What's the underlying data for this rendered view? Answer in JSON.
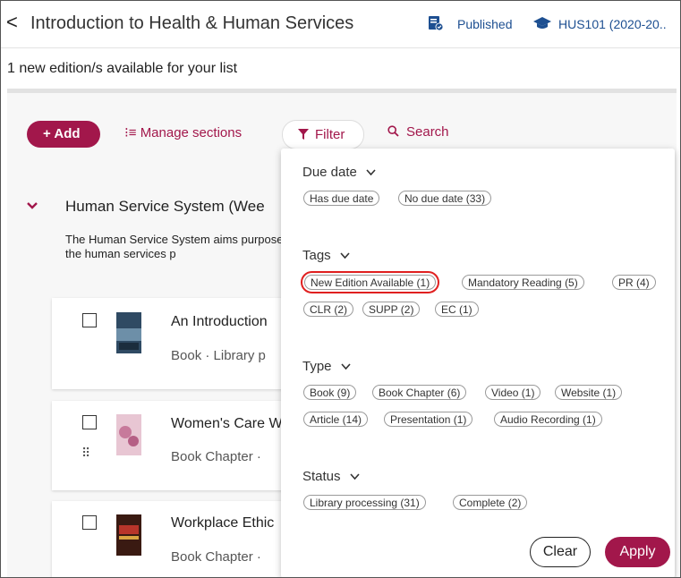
{
  "header": {
    "back_glyph": "<",
    "title": "Introduction to Health & Human Services",
    "status": "Published",
    "course": "HUS101 (2020-20.."
  },
  "notice": {
    "text": "1 new edition/s available for your list"
  },
  "toolbar": {
    "add_label": "+ Add",
    "manage_label": "⁝≡ Manage sections",
    "filter_label": "Filter",
    "search_label": "Search"
  },
  "section": {
    "title": "Human Service System (Wee",
    "description": "The Human Service System aims purpose of the human services p"
  },
  "cards": [
    {
      "title": "An Introduction",
      "meta": "Book · Library p"
    },
    {
      "title": "Women's Care W",
      "meta": "Book Chapter ·"
    },
    {
      "title": "Workplace Ethic",
      "meta": "Book Chapter ·"
    }
  ],
  "filter_panel": {
    "groups": [
      {
        "label": "Due date",
        "chips": [
          "Has due date",
          "No due date (33)"
        ]
      },
      {
        "label": "Tags",
        "chips": [
          "New Edition Available (1)",
          "Mandatory Reading (5)",
          "PR (4)",
          "CLR (2)",
          "SUPP (2)",
          "EC (1)"
        ]
      },
      {
        "label": "Type",
        "chips": [
          "Book (9)",
          "Book Chapter (6)",
          "Video (1)",
          "Website (1)",
          "Article (14)",
          "Presentation (1)",
          "Audio Recording (1)"
        ]
      },
      {
        "label": "Status",
        "chips": [
          "Library processing (31)",
          "Complete (2)"
        ]
      }
    ],
    "selected_chip": "New Edition Available (1)",
    "clear_label": "Clear",
    "apply_label": "Apply"
  },
  "colors": {
    "accent": "#a2174b",
    "link_blue": "#1d4f91",
    "highlight": "#e02020"
  }
}
